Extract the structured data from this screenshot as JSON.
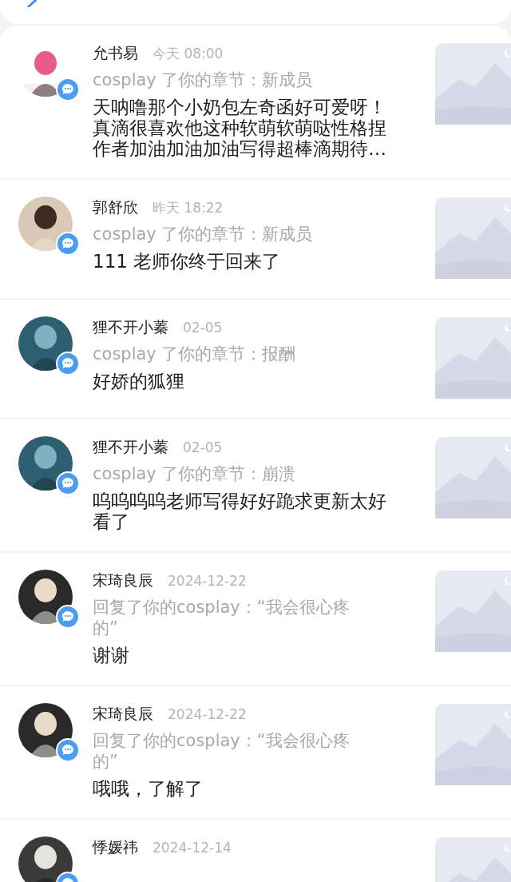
{
  "notifications": [
    {
      "name": "允书易",
      "time": "今天 08:00",
      "action": "cosplay 了你的章节：新成员",
      "comment": "天呐噜那个小奶包左奇函好可爱呀！真滴很喜欢他这种软萌软萌哒性格捏作者加油加油加油写得超棒滴期待…"
    },
    {
      "name": "郭舒欣",
      "time": "昨天 18:22",
      "action": "cosplay 了你的章节：新成员",
      "comment": "111 老师你终于回来了"
    },
    {
      "name": "狸不开小蓁",
      "time": "02-05",
      "action": "cosplay 了你的章节：报酬",
      "comment": "好娇的狐狸"
    },
    {
      "name": "狸不开小蓁",
      "time": "02-05",
      "action": "cosplay 了你的章节：崩溃",
      "comment": "呜呜呜呜老师写得好好跪求更新太好看了"
    },
    {
      "name": "宋琦良辰",
      "time": "2024-12-22",
      "action": "回复了你的cosplay：“我会很心疼的”",
      "comment": "谢谢"
    },
    {
      "name": "宋琦良辰",
      "time": "2024-12-22",
      "action": "回复了你的cosplay：“我会很心疼的”",
      "comment": "哦哦，了解了"
    },
    {
      "name": "悸媛祎",
      "time": "2024-12-14"
    }
  ]
}
